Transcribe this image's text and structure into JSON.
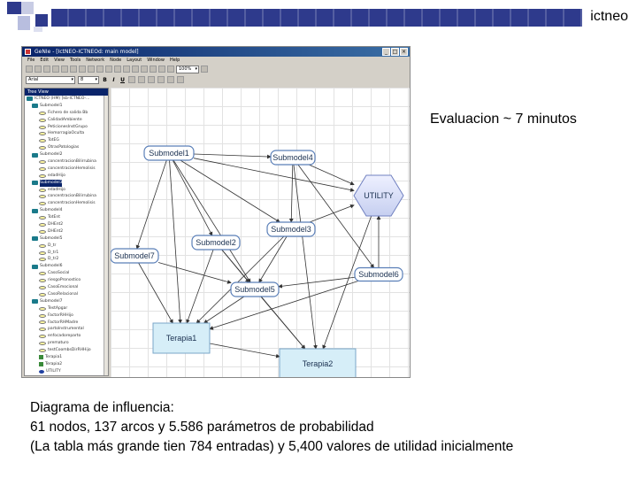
{
  "slide": {
    "brand": "ictneo",
    "subtitle": "Evaluacion ~ 7 minutos",
    "caption": [
      "Diagrama de influencia:",
      "61 nodos, 137 arcos y 5.586 parámetros de probabilidad",
      "(La tabla más grande tien 784 entradas) y 5,400 valores de utilidad inicialmente"
    ],
    "colors": {
      "bar": "#2e3a8c",
      "decor_light": "#b8bedf"
    }
  },
  "app": {
    "title": "GeNIe - [IctNEO-ICTNEOd: main model]",
    "menu": [
      "File",
      "Edit",
      "View",
      "Tools",
      "Network",
      "Node",
      "Layout",
      "Window",
      "Help"
    ],
    "font_combo": "Arial",
    "size_combo": "8",
    "zoom_combo": "100%",
    "tree": {
      "header": "Tree View",
      "items": [
        {
          "label": "ICTNEO (HM) [kb-ICTNEO-...",
          "kind": "folder",
          "selected": false
        },
        {
          "label": "Submodel1",
          "kind": "folder",
          "selected": false
        },
        {
          "label": "Fichero de salida Bb",
          "kind": "dot",
          "selected": false
        },
        {
          "label": "CalidadAmbiente",
          "kind": "dot",
          "selected": false
        },
        {
          "label": "PeticionesInstGrupo",
          "kind": "dot",
          "selected": false
        },
        {
          "label": "HemorragiaOculta",
          "kind": "dot",
          "selected": false
        },
        {
          "label": "TotEG",
          "kind": "dot",
          "selected": false
        },
        {
          "label": "OtrasPatologias",
          "kind": "dot",
          "selected": false
        },
        {
          "label": "Submodel2",
          "kind": "folder",
          "selected": false
        },
        {
          "label": "concentracionBilirrubina",
          "kind": "dot",
          "selected": false
        },
        {
          "label": "concentracionHemolisis",
          "kind": "dot",
          "selected": false
        },
        {
          "label": "edadHijo",
          "kind": "dot",
          "selected": false
        },
        {
          "label": "Submodel3",
          "kind": "folder",
          "selected": true
        },
        {
          "label": "edadHijo",
          "kind": "dot",
          "selected": false
        },
        {
          "label": "concentracionBilirrubina",
          "kind": "dot",
          "selected": false
        },
        {
          "label": "concentracionHemolisis",
          "kind": "dot",
          "selected": false
        },
        {
          "label": "Submodel4",
          "kind": "folder",
          "selected": false
        },
        {
          "label": "TotEnt",
          "kind": "dot",
          "selected": false
        },
        {
          "label": "DHEnt2",
          "kind": "dot",
          "selected": false
        },
        {
          "label": "DHEnt2",
          "kind": "dot",
          "selected": false
        },
        {
          "label": "Submodel5",
          "kind": "folder",
          "selected": false
        },
        {
          "label": "D_tr",
          "kind": "dot",
          "selected": false
        },
        {
          "label": "D_tr1",
          "kind": "dot",
          "selected": false
        },
        {
          "label": "D_tr2",
          "kind": "dot",
          "selected": false
        },
        {
          "label": "Submodel6",
          "kind": "folder",
          "selected": false
        },
        {
          "label": "CasoSocial",
          "kind": "dot",
          "selected": false
        },
        {
          "label": "riesgoPronostico",
          "kind": "dot",
          "selected": false
        },
        {
          "label": "CasoEmocional",
          "kind": "dot",
          "selected": false
        },
        {
          "label": "CasoRelacional",
          "kind": "dot",
          "selected": false
        },
        {
          "label": "Submodel7",
          "kind": "folder",
          "selected": false
        },
        {
          "label": "TestApgar",
          "kind": "dot",
          "selected": false
        },
        {
          "label": "FactorRHHijo",
          "kind": "dot",
          "selected": false
        },
        {
          "label": "FactorRHMadre",
          "kind": "dot",
          "selected": false
        },
        {
          "label": "partoInstrumental",
          "kind": "dot",
          "selected": false
        },
        {
          "label": "enfocadoreparto",
          "kind": "dot",
          "selected": false
        },
        {
          "label": "prematuro",
          "kind": "dot",
          "selected": false
        },
        {
          "label": "testCoombsDirRHHijo",
          "kind": "dot",
          "selected": false
        },
        {
          "label": "Terapia1",
          "kind": "sq",
          "selected": false
        },
        {
          "label": "Terapia2",
          "kind": "sq",
          "selected": false
        },
        {
          "label": "UTILITY",
          "kind": "dia",
          "selected": false
        }
      ]
    },
    "diagram": {
      "nodes": [
        {
          "id": "s1",
          "label": "Submodel1",
          "type": "submodel"
        },
        {
          "id": "s4",
          "label": "Submodel4",
          "type": "submodel"
        },
        {
          "id": "s3",
          "label": "Submodel3",
          "type": "submodel"
        },
        {
          "id": "s2",
          "label": "Submodel2",
          "type": "submodel"
        },
        {
          "id": "s7",
          "label": "Submodel7",
          "type": "submodel"
        },
        {
          "id": "s6",
          "label": "Submodel6",
          "type": "submodel"
        },
        {
          "id": "s5",
          "label": "Submodel5",
          "type": "submodel"
        },
        {
          "id": "t1",
          "label": "Terapia1",
          "type": "decision"
        },
        {
          "id": "t2",
          "label": "Terapia2",
          "type": "decision"
        },
        {
          "id": "u",
          "label": "UTILITY",
          "type": "utility"
        }
      ],
      "edges": [
        [
          "s1",
          "s4"
        ],
        [
          "s1",
          "u"
        ],
        [
          "s1",
          "s2"
        ],
        [
          "s1",
          "s3"
        ],
        [
          "s1",
          "s7"
        ],
        [
          "s1",
          "s5"
        ],
        [
          "s1",
          "t1"
        ],
        [
          "s4",
          "s3"
        ],
        [
          "s4",
          "u"
        ],
        [
          "s4",
          "s6"
        ],
        [
          "s4",
          "t2"
        ],
        [
          "s3",
          "u"
        ],
        [
          "s3",
          "s5"
        ],
        [
          "s3",
          "t1"
        ],
        [
          "s2",
          "s5"
        ],
        [
          "s2",
          "t2"
        ],
        [
          "s2",
          "t1"
        ],
        [
          "s7",
          "s5"
        ],
        [
          "s7",
          "t1"
        ],
        [
          "s6",
          "s5"
        ],
        [
          "s6",
          "t1"
        ],
        [
          "s6",
          "u"
        ],
        [
          "s5",
          "t1"
        ],
        [
          "s5",
          "t2"
        ],
        [
          "t1",
          "t2"
        ],
        [
          "u",
          "t2"
        ]
      ]
    }
  }
}
